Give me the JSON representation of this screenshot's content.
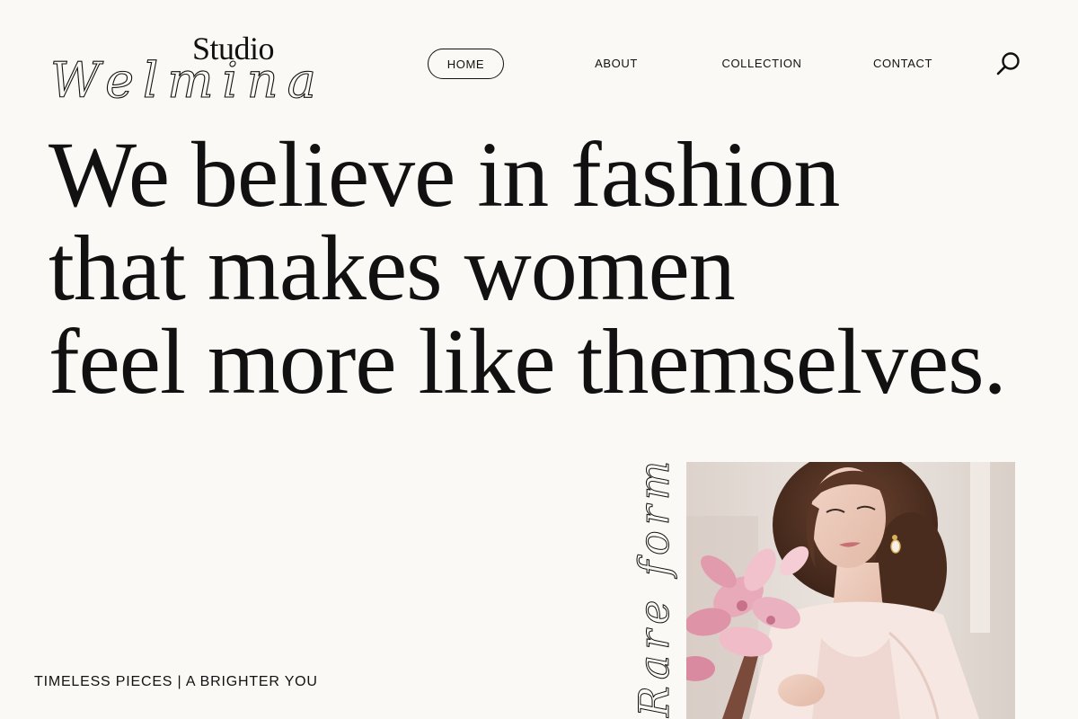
{
  "logo": {
    "studio": "Studio",
    "script": "Welmina"
  },
  "nav": {
    "items": [
      {
        "label": "HOME",
        "active": true
      },
      {
        "label": "ABOUT",
        "active": false
      },
      {
        "label": "COLLECTION",
        "active": false
      },
      {
        "label": "CONTACT",
        "active": false
      }
    ],
    "search_icon": "search-icon"
  },
  "hero": {
    "headline_lines": [
      "We believe in fashion",
      "that makes women",
      "feel more like themselves."
    ]
  },
  "tagline": "TIMELESS PIECES | A BRIGHTER YOU",
  "vertical_script": "Rare form",
  "photo": {
    "subject": "woman-holding-pink-magnolias"
  },
  "colors": {
    "background": "#fbf9f5",
    "text": "#111111",
    "photo_bg": "#e8ddd6",
    "flowers": "#e8a9b8"
  }
}
